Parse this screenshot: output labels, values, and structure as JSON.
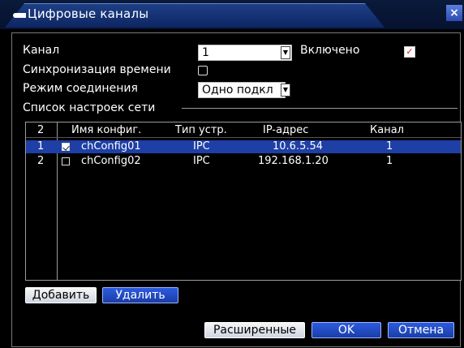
{
  "window": {
    "title": "Цифровые каналы",
    "close_label": "×"
  },
  "form": {
    "channel_label": "Канал",
    "channel_value": "1",
    "enabled_label": "Включено",
    "time_sync_label": "Синхронизация времени",
    "conn_mode_label": "Режим соединения",
    "conn_mode_value": "Одно подкл",
    "net_list_label": "Список настроек сети"
  },
  "table": {
    "count": "2",
    "columns": [
      "Имя конфиг.",
      "Тип устр.",
      "IP-адрес",
      "Канал"
    ],
    "rows": [
      {
        "num": "1",
        "checked": true,
        "name": "chConfig01",
        "type": "IPC",
        "ip": "10.6.5.54",
        "channel": "1",
        "selected": true
      },
      {
        "num": "2",
        "checked": false,
        "name": "chConfig02",
        "type": "IPC",
        "ip": "192.168.1.20",
        "channel": "1",
        "selected": false
      }
    ]
  },
  "buttons": {
    "add": "Добавить",
    "delete": "Удалить",
    "advanced": "Расширенные",
    "ok": "OK",
    "cancel": "Отмена"
  }
}
